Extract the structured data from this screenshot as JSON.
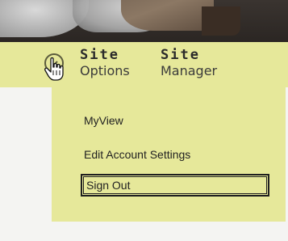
{
  "nav": {
    "site_options": {
      "line1": "Site",
      "line2": "Options"
    },
    "site_manager": {
      "line1": "Site",
      "line2": "Manager"
    },
    "options_icon": "settings-circle-icon",
    "cursor_icon": "hand-pointer-icon"
  },
  "dropdown": {
    "items": [
      {
        "label": "MyView"
      },
      {
        "label": "Edit Account Settings"
      },
      {
        "label": "Sign Out"
      }
    ]
  },
  "colors": {
    "nav_background": "#e6e89a",
    "text": "#2a2a2a",
    "focus_border": "#1f1f1f"
  }
}
